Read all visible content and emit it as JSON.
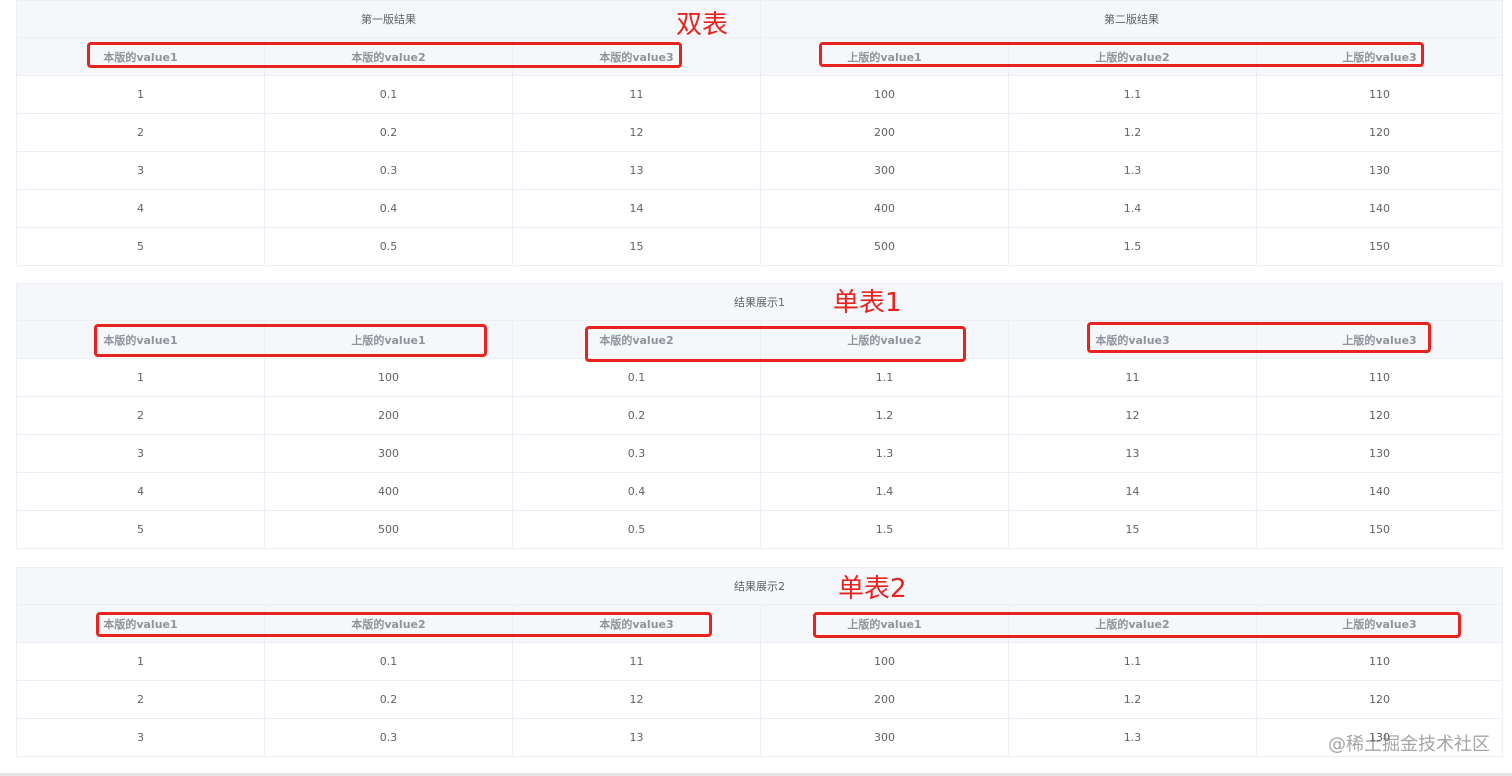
{
  "table1": {
    "groups": [
      "第一版结果",
      "第二版结果"
    ],
    "headers": [
      "本版的value1",
      "本版的value2",
      "本版的value3",
      "上版的value1",
      "上版的value2",
      "上版的value3"
    ],
    "rows": [
      [
        "1",
        "0.1",
        "11",
        "100",
        "1.1",
        "110"
      ],
      [
        "2",
        "0.2",
        "12",
        "200",
        "1.2",
        "120"
      ],
      [
        "3",
        "0.3",
        "13",
        "300",
        "1.3",
        "130"
      ],
      [
        "4",
        "0.4",
        "14",
        "400",
        "1.4",
        "140"
      ],
      [
        "5",
        "0.5",
        "15",
        "500",
        "1.5",
        "150"
      ]
    ]
  },
  "table2": {
    "group": "结果展示1",
    "headers": [
      "本版的value1",
      "上版的value1",
      "本版的value2",
      "上版的value2",
      "本版的value3",
      "上版的value3"
    ],
    "rows": [
      [
        "1",
        "100",
        "0.1",
        "1.1",
        "11",
        "110"
      ],
      [
        "2",
        "200",
        "0.2",
        "1.2",
        "12",
        "120"
      ],
      [
        "3",
        "300",
        "0.3",
        "1.3",
        "13",
        "130"
      ],
      [
        "4",
        "400",
        "0.4",
        "1.4",
        "14",
        "140"
      ],
      [
        "5",
        "500",
        "0.5",
        "1.5",
        "15",
        "150"
      ]
    ]
  },
  "table3": {
    "group": "结果展示2",
    "headers": [
      "本版的value1",
      "本版的value2",
      "本版的value3",
      "上版的value1",
      "上版的value2",
      "上版的value3"
    ],
    "rows": [
      [
        "1",
        "0.1",
        "11",
        "100",
        "1.1",
        "110"
      ],
      [
        "2",
        "0.2",
        "12",
        "200",
        "1.2",
        "120"
      ],
      [
        "3",
        "0.3",
        "13",
        "300",
        "1.3",
        "130"
      ]
    ]
  },
  "annotations": {
    "double_table": "双表",
    "single_table_1": "单表1",
    "single_table_2": "单表2"
  },
  "annotation_color": "#e8231e",
  "header_bg": "#f5f7fa",
  "border_color": "#ebeef5",
  "watermark": "@稀土掘金技术社区"
}
